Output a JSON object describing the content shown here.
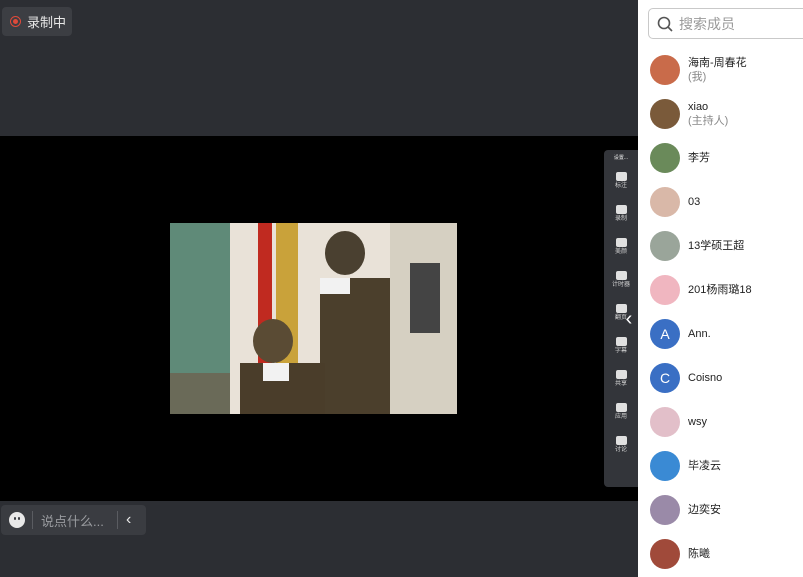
{
  "recording": {
    "label": "录制中"
  },
  "toolbar": {
    "top_label": "设置...",
    "items": [
      {
        "label": "标注",
        "icon": "pen-icon"
      },
      {
        "label": "录制",
        "icon": "record-icon"
      },
      {
        "label": "美颜",
        "icon": "beauty-icon"
      },
      {
        "label": "计时器",
        "icon": "timer-icon"
      },
      {
        "label": "翻页",
        "icon": "page-icon"
      },
      {
        "label": "字幕",
        "icon": "subtitle-icon"
      },
      {
        "label": "共享",
        "icon": "screen-share-icon"
      },
      {
        "label": "应用",
        "icon": "apps-icon"
      },
      {
        "label": "讨论",
        "icon": "discussion-icon"
      }
    ]
  },
  "chat": {
    "placeholder": "说点什么..."
  },
  "panel": {
    "search_placeholder": "搜索成员",
    "members": [
      {
        "name": "海南-周春花",
        "role": "(我)",
        "avatar_color": "#c96b4a"
      },
      {
        "name": "xiao",
        "role": "(主持人)",
        "avatar_color": "#7a5a3a"
      },
      {
        "name": "李芳",
        "role": "",
        "avatar_color": "#6a8a5a"
      },
      {
        "name": "03",
        "role": "",
        "avatar_color": "#d9b8a8"
      },
      {
        "name": "13学硕王超",
        "role": "",
        "avatar_color": "#9aa59a"
      },
      {
        "name": "201杨雨璐18",
        "role": "",
        "avatar_color": "#f0b6c0"
      },
      {
        "name": "Ann.",
        "role": "",
        "avatar_color": "#3a6fc4",
        "initial": "A"
      },
      {
        "name": "Coisno",
        "role": "",
        "avatar_color": "#3a6fc4",
        "initial": "C"
      },
      {
        "name": "wsy",
        "role": "",
        "avatar_color": "#e2bfc9"
      },
      {
        "name": "毕凌云",
        "role": "",
        "avatar_color": "#3a8ad4"
      },
      {
        "name": "边奕安",
        "role": "",
        "avatar_color": "#9a8aa8"
      },
      {
        "name": "陈曦",
        "role": "",
        "avatar_color": "#a04a3a"
      }
    ]
  }
}
